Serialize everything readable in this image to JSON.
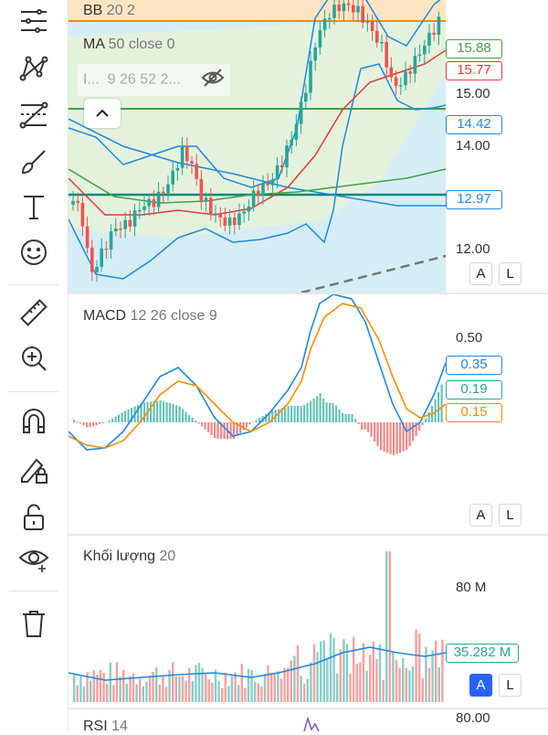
{
  "toolbar": {
    "tools": [
      {
        "icon": "menu-lines-icon"
      },
      {
        "icon": "trend-pattern-icon"
      },
      {
        "icon": "fib-levels-icon"
      },
      {
        "icon": "brush-icon"
      },
      {
        "icon": "text-tool-icon"
      },
      {
        "icon": "emoji-icon"
      },
      {
        "icon": "ruler-icon"
      },
      {
        "icon": "zoom-in-icon"
      },
      {
        "icon": "magnet-icon"
      },
      {
        "icon": "lock-drawing-icon"
      },
      {
        "icon": "unlock-icon"
      },
      {
        "icon": "eye-icon"
      },
      {
        "icon": "trash-icon"
      }
    ]
  },
  "price_pane": {
    "legend": {
      "bb": {
        "name": "BB",
        "params": "20 2"
      },
      "ma": {
        "name": "MA",
        "params": "50 close 0"
      },
      "third": {
        "name": "I...",
        "params": "9 26 52 2..."
      }
    },
    "axis_labels": [
      "15.00",
      "14.00",
      "12.00"
    ],
    "price_tags": [
      {
        "text": "15.88",
        "color": "#43a047"
      },
      {
        "text": "15.77",
        "color": "#e53935"
      },
      {
        "text": "14.42",
        "color": "#1e88e5"
      },
      {
        "text": "12.97",
        "color": "#1e88e5"
      }
    ],
    "scale_buttons": {
      "a": "A",
      "l": "L"
    }
  },
  "macd_pane": {
    "legend": {
      "name": "MACD",
      "params": "12 26 close 9"
    },
    "axis_labels": [
      "0.50"
    ],
    "price_tags": [
      {
        "text": "0.35",
        "color": "#1e88e5"
      },
      {
        "text": "0.19",
        "color": "#26a69a"
      },
      {
        "text": "0.15",
        "color": "#fb8c00"
      }
    ],
    "scale_buttons": {
      "a": "A",
      "l": "L"
    }
  },
  "volume_pane": {
    "legend": {
      "name": "Khối lượng",
      "params": "20"
    },
    "axis_labels": [
      "80 M"
    ],
    "price_tags": [
      {
        "text": "35.282 M",
        "color": "#26a69a"
      }
    ],
    "scale_buttons": {
      "a": "A",
      "l": "L"
    }
  },
  "rsi_pane": {
    "legend": {
      "name": "RSI",
      "params": "14"
    },
    "axis_labels": [
      "80.00"
    ]
  },
  "colors": {
    "up": "#26a69a",
    "down": "#ef5350",
    "bb": "#1e88e5",
    "ma": "#43a047",
    "orange": "#fb8c00",
    "accent": "#2962ff"
  }
}
